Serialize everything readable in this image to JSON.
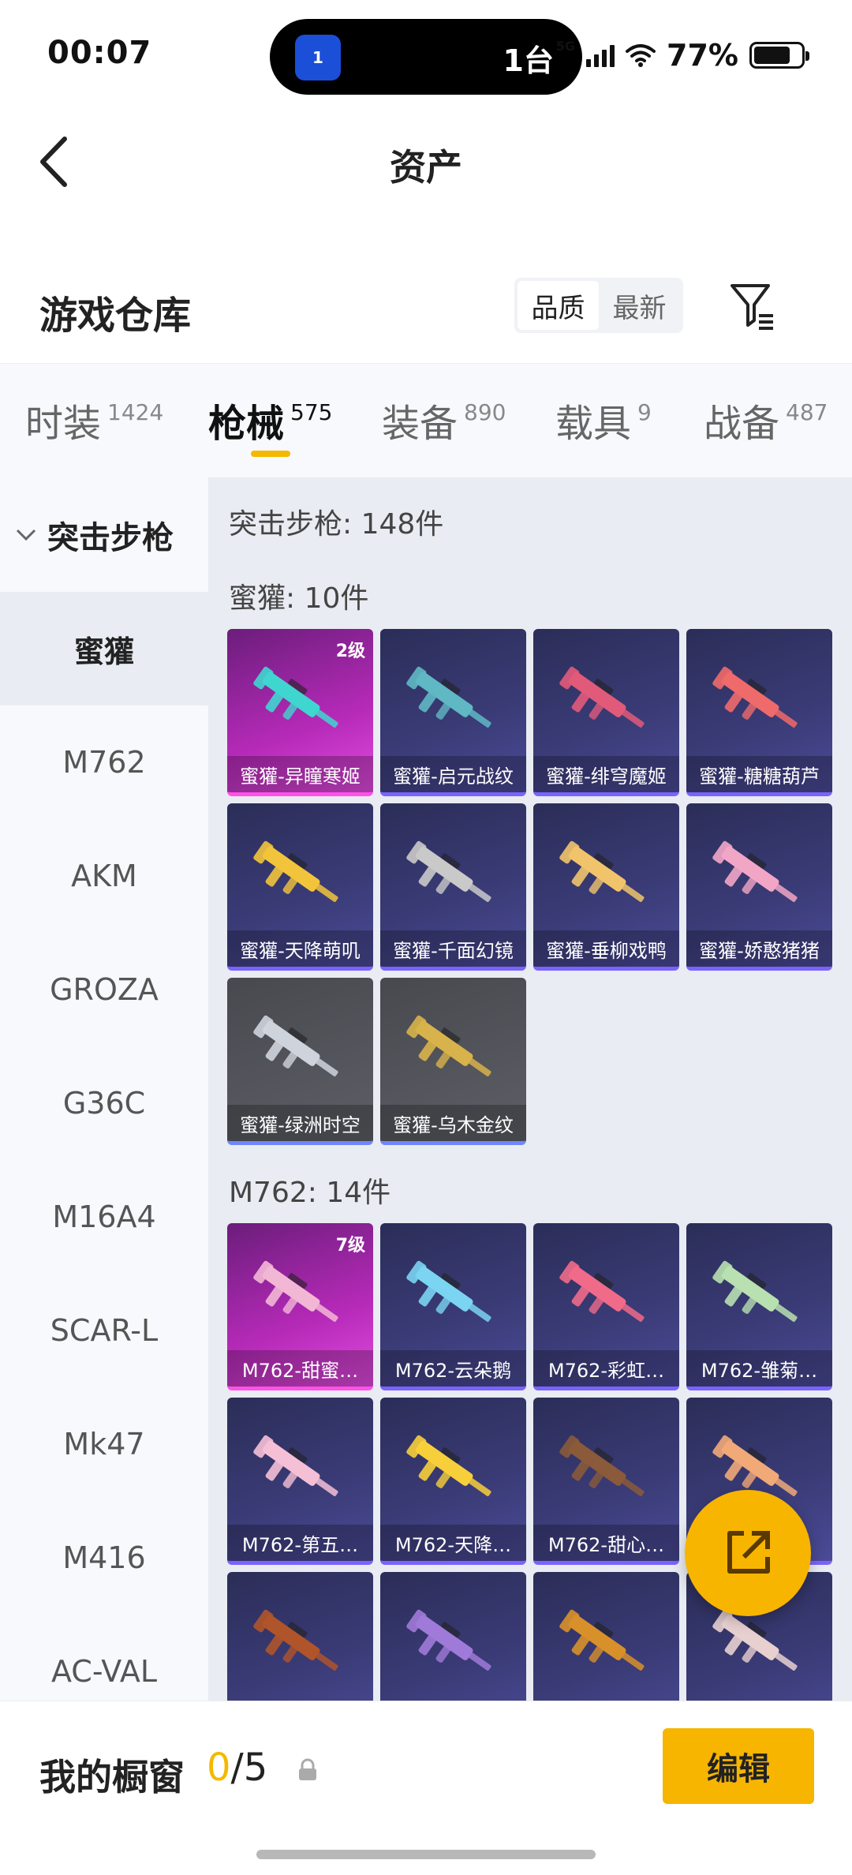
{
  "status": {
    "time": "00:07",
    "island_badge": "1",
    "island_text": "1台",
    "network": "5G",
    "battery": "77%"
  },
  "header": {
    "title": "资产"
  },
  "section": {
    "title": "游戏仓库",
    "sort": [
      "品质",
      "最新"
    ]
  },
  "tabs": [
    {
      "label": "时装",
      "count": "1424"
    },
    {
      "label": "枪械",
      "count": "575"
    },
    {
      "label": "装备",
      "count": "890"
    },
    {
      "label": "载具",
      "count": "9"
    },
    {
      "label": "战备",
      "count": "487"
    }
  ],
  "sidebar": {
    "group": "突击步枪",
    "items": [
      "蜜獾",
      "M762",
      "AKM",
      "GROZA",
      "G36C",
      "M16A4",
      "SCAR-L",
      "Mk47",
      "M416",
      "AC-VAL"
    ]
  },
  "content": {
    "category_header": "突击步枪: 148件",
    "groups": [
      {
        "header": "蜜獾: 10件",
        "items": [
          {
            "name": "蜜獾-异瞳寒姬",
            "level": "2级",
            "style": "pink"
          },
          {
            "name": "蜜獾-启元战纹",
            "level": "",
            "style": "purple"
          },
          {
            "name": "蜜獾-绯穹魔姬",
            "level": "",
            "style": "purple"
          },
          {
            "name": "蜜獾-糖糖葫芦",
            "level": "",
            "style": "purple"
          },
          {
            "name": "蜜獾-天降萌叽",
            "level": "",
            "style": "purple"
          },
          {
            "name": "蜜獾-千面幻镜",
            "level": "",
            "style": "purple"
          },
          {
            "name": "蜜獾-垂柳戏鸭",
            "level": "",
            "style": "purple"
          },
          {
            "name": "蜜獾-娇憨猪猪",
            "level": "",
            "style": "purple"
          },
          {
            "name": "蜜獾-绿洲时空",
            "level": "",
            "style": "grey"
          },
          {
            "name": "蜜獾-乌木金纹",
            "level": "",
            "style": "grey"
          }
        ]
      },
      {
        "header": "M762: 14件",
        "items": [
          {
            "name": "M762-甜蜜…",
            "level": "7级",
            "style": "pink"
          },
          {
            "name": "M762-云朵鹅",
            "level": "",
            "style": "purple"
          },
          {
            "name": "M762-彩虹…",
            "level": "",
            "style": "purple"
          },
          {
            "name": "M762-雏菊…",
            "level": "",
            "style": "purple"
          },
          {
            "name": "M762-第五…",
            "level": "",
            "style": "purple"
          },
          {
            "name": "M762-天降…",
            "level": "",
            "style": "purple"
          },
          {
            "name": "M762-甜心…",
            "level": "",
            "style": "purple"
          },
          {
            "name": "",
            "level": "",
            "style": "purple"
          },
          {
            "name": "",
            "level": "",
            "style": "purple"
          },
          {
            "name": "",
            "level": "",
            "style": "purple"
          },
          {
            "name": "",
            "level": "",
            "style": "purple"
          },
          {
            "name": "",
            "level": "",
            "style": "purple"
          }
        ]
      }
    ]
  },
  "showcase": {
    "label": "我的橱窗",
    "count": "0",
    "total": "/5",
    "edit_label": "编辑"
  },
  "colors": {
    "accent": "#f7b500",
    "pink_card": "#c02ec0",
    "purple_card": "#3b3c78",
    "grey_card": "#55575e"
  }
}
